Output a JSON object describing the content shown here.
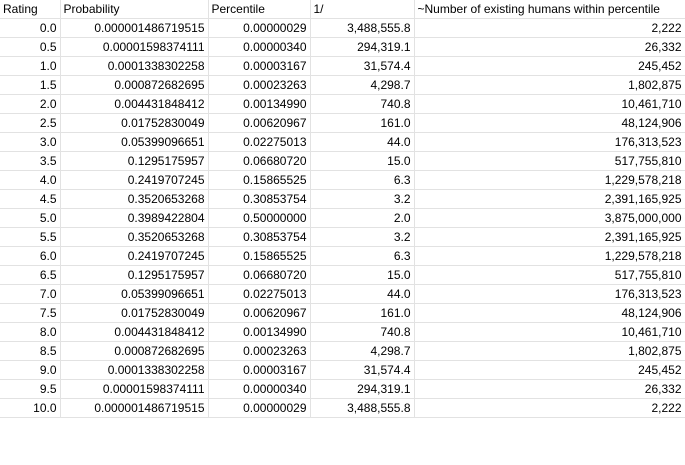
{
  "sheet": {
    "headers": [
      "Rating",
      "Probability",
      "Percentile",
      "1/",
      "~Number of existing humans within percentile"
    ],
    "rows": [
      [
        "0.0",
        "0.000001486719515",
        "0.00000029",
        "3,488,555.8",
        "2,222"
      ],
      [
        "0.5",
        "0.00001598374111",
        "0.00000340",
        "294,319.1",
        "26,332"
      ],
      [
        "1.0",
        "0.0001338302258",
        "0.00003167",
        "31,574.4",
        "245,452"
      ],
      [
        "1.5",
        "0.000872682695",
        "0.00023263",
        "4,298.7",
        "1,802,875"
      ],
      [
        "2.0",
        "0.004431848412",
        "0.00134990",
        "740.8",
        "10,461,710"
      ],
      [
        "2.5",
        "0.01752830049",
        "0.00620967",
        "161.0",
        "48,124,906"
      ],
      [
        "3.0",
        "0.05399096651",
        "0.02275013",
        "44.0",
        "176,313,523"
      ],
      [
        "3.5",
        "0.1295175957",
        "0.06680720",
        "15.0",
        "517,755,810"
      ],
      [
        "4.0",
        "0.2419707245",
        "0.15865525",
        "6.3",
        "1,229,578,218"
      ],
      [
        "4.5",
        "0.3520653268",
        "0.30853754",
        "3.2",
        "2,391,165,925"
      ],
      [
        "5.0",
        "0.3989422804",
        "0.50000000",
        "2.0",
        "3,875,000,000"
      ],
      [
        "5.5",
        "0.3520653268",
        "0.30853754",
        "3.2",
        "2,391,165,925"
      ],
      [
        "6.0",
        "0.2419707245",
        "0.15865525",
        "6.3",
        "1,229,578,218"
      ],
      [
        "6.5",
        "0.1295175957",
        "0.06680720",
        "15.0",
        "517,755,810"
      ],
      [
        "7.0",
        "0.05399096651",
        "0.02275013",
        "44.0",
        "176,313,523"
      ],
      [
        "7.5",
        "0.01752830049",
        "0.00620967",
        "161.0",
        "48,124,906"
      ],
      [
        "8.0",
        "0.004431848412",
        "0.00134990",
        "740.8",
        "10,461,710"
      ],
      [
        "8.5",
        "0.000872682695",
        "0.00023263",
        "4,298.7",
        "1,802,875"
      ],
      [
        "9.0",
        "0.0001338302258",
        "0.00003167",
        "31,574.4",
        "245,452"
      ],
      [
        "9.5",
        "0.00001598374111",
        "0.00000340",
        "294,319.1",
        "26,332"
      ],
      [
        "10.0",
        "0.000001486719515",
        "0.00000029",
        "3,488,555.8",
        "2,222"
      ]
    ]
  }
}
